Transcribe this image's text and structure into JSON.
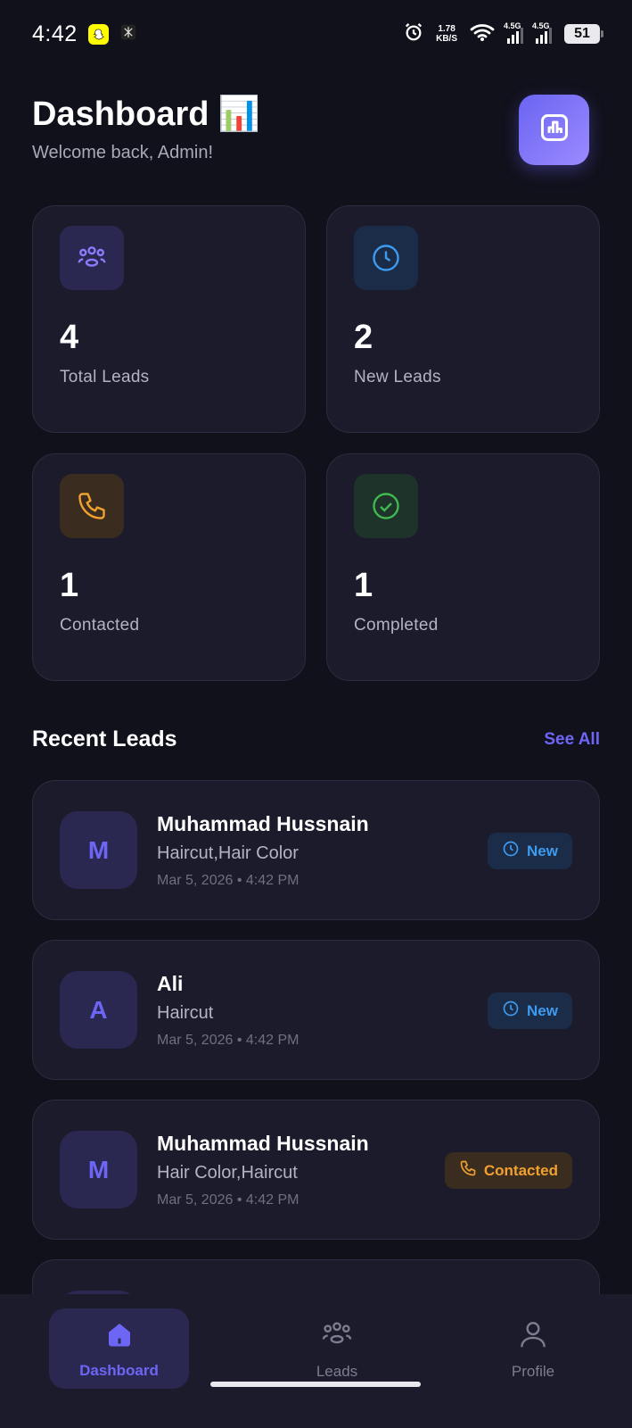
{
  "status_bar": {
    "time": "4:42",
    "net_speed_value": "1.78",
    "net_speed_unit": "KB/S",
    "signal1_label": "4.5G",
    "signal2_label": "4.5G",
    "battery": "51"
  },
  "header": {
    "title": "Dashboard",
    "title_emoji": "📊",
    "subtitle": "Welcome back, Admin!",
    "action_icon": "bar-chart-icon"
  },
  "stats": [
    {
      "value": "4",
      "label": "Total Leads",
      "icon": "users-icon",
      "color": "#8a7cff",
      "bg": "#2a2850"
    },
    {
      "value": "2",
      "label": "New Leads",
      "icon": "clock-icon",
      "color": "#3d9bf0",
      "bg": "#1b2c48"
    },
    {
      "value": "1",
      "label": "Contacted",
      "icon": "phone-icon",
      "color": "#f0a12f",
      "bg": "#3a2c1f"
    },
    {
      "value": "1",
      "label": "Completed",
      "icon": "check-circle-icon",
      "color": "#3fb950",
      "bg": "#1e3329"
    }
  ],
  "recent": {
    "title": "Recent Leads",
    "see_all": "See All"
  },
  "leads": [
    {
      "initial": "M",
      "name": "Muhammad Hussnain",
      "services": "Haircut,Hair Color",
      "time": "Mar 5, 2026 • 4:42 PM",
      "status": "New"
    },
    {
      "initial": "A",
      "name": "Ali",
      "services": "Haircut",
      "time": "Mar 5, 2026 • 4:42 PM",
      "status": "New"
    },
    {
      "initial": "M",
      "name": "Muhammad Hussnain",
      "services": "Hair Color,Haircut",
      "time": "Mar 5, 2026 • 4:42 PM",
      "status": "Contacted"
    }
  ],
  "nav": [
    {
      "label": "Dashboard",
      "icon": "home-icon",
      "active": true
    },
    {
      "label": "Leads",
      "icon": "users-icon",
      "active": false
    },
    {
      "label": "Profile",
      "icon": "user-icon",
      "active": false
    }
  ]
}
